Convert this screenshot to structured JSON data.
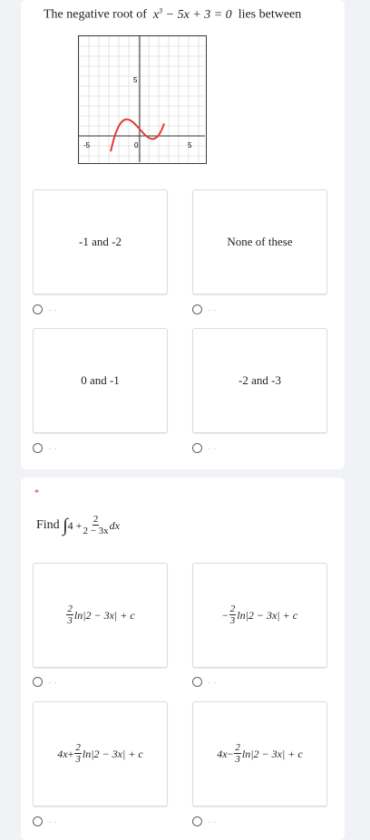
{
  "q1": {
    "prefix": "The negative root of",
    "eq_x3": "x",
    "eq_exp": "3",
    "eq_rest": " − 5x + 3 = 0",
    "suffix": "lies between",
    "graph": {
      "x_labels": [
        "-5",
        "0",
        "5"
      ],
      "y_label": "5",
      "curve_color": "#e53935",
      "axis_color": "#333333",
      "grid_color": "#d0d0d0"
    },
    "options": [
      "-1 and -2",
      "None of these",
      "0 and -1",
      "-2 and -3"
    ],
    "dots": ". ."
  },
  "q2": {
    "required_mark": "*",
    "prefix": "Find",
    "integral": "∫",
    "term": "4 +",
    "frac_num": "2",
    "frac_den": "2 − 3x",
    "dx": "dx",
    "options": [
      {
        "lead": "",
        "sign": "",
        "num": "2",
        "den": "3",
        "tail": "ln|2 − 3x| + c"
      },
      {
        "lead": "",
        "sign": "−",
        "num": "2",
        "den": "3",
        "tail": "ln|2 − 3x| + c"
      },
      {
        "lead": "4x",
        "sign": "+",
        "num": "2",
        "den": "3",
        "tail": "ln|2 − 3x| + c"
      },
      {
        "lead": "4x",
        "sign": "−",
        "num": "2",
        "den": "3",
        "tail": "ln|2 − 3x| + c"
      }
    ],
    "dots": ". ."
  }
}
